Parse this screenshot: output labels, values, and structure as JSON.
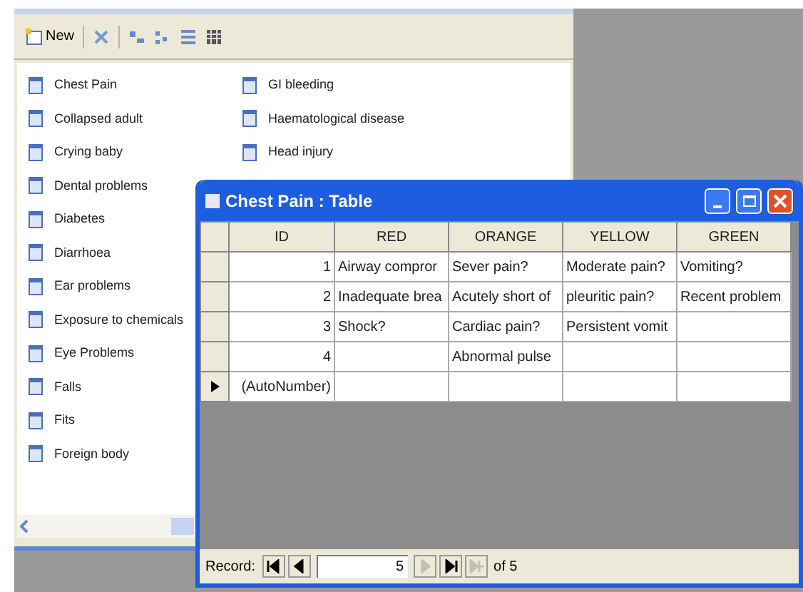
{
  "database_window": {
    "toolbar": {
      "new_label": "New"
    },
    "objects": [
      "Chest Pain",
      "Collapsed adult",
      "Crying baby",
      "Dental problems",
      "Diabetes",
      "Diarrhoea",
      "Ear problems",
      "Exposure to chemicals",
      "Eye Problems",
      "Falls",
      "Fits",
      "Foreign body",
      "GI bleeding",
      "Haematological disease",
      "Head injury"
    ]
  },
  "table_window": {
    "title": "Chest Pain : Table",
    "columns": [
      "ID",
      "RED",
      "ORANGE",
      "YELLOW",
      "GREEN"
    ],
    "rows": [
      {
        "current": false,
        "cells": [
          "1",
          "Airway compror",
          "Sever pain?",
          "Moderate pain?",
          "Vomiting?"
        ]
      },
      {
        "current": false,
        "cells": [
          "2",
          "Inadequate brea",
          "Acutely short of",
          "pleuritic pain?",
          "Recent problem"
        ]
      },
      {
        "current": false,
        "cells": [
          "3",
          "Shock?",
          "Cardiac pain?",
          "Persistent vomit",
          ""
        ]
      },
      {
        "current": false,
        "cells": [
          "4",
          "",
          "Abnormal pulse",
          "",
          ""
        ]
      },
      {
        "current": true,
        "cells": [
          "(AutoNumber)",
          "",
          "",
          "",
          ""
        ]
      }
    ],
    "record_bar": {
      "label": "Record:",
      "value": "5",
      "total": "of 5",
      "nav_buttons": [
        {
          "kind": "first",
          "disabled": false
        },
        {
          "kind": "previous",
          "disabled": false
        },
        {
          "kind": "next",
          "disabled": true
        },
        {
          "kind": "last",
          "disabled": false
        },
        {
          "kind": "new",
          "disabled": true
        }
      ]
    }
  }
}
